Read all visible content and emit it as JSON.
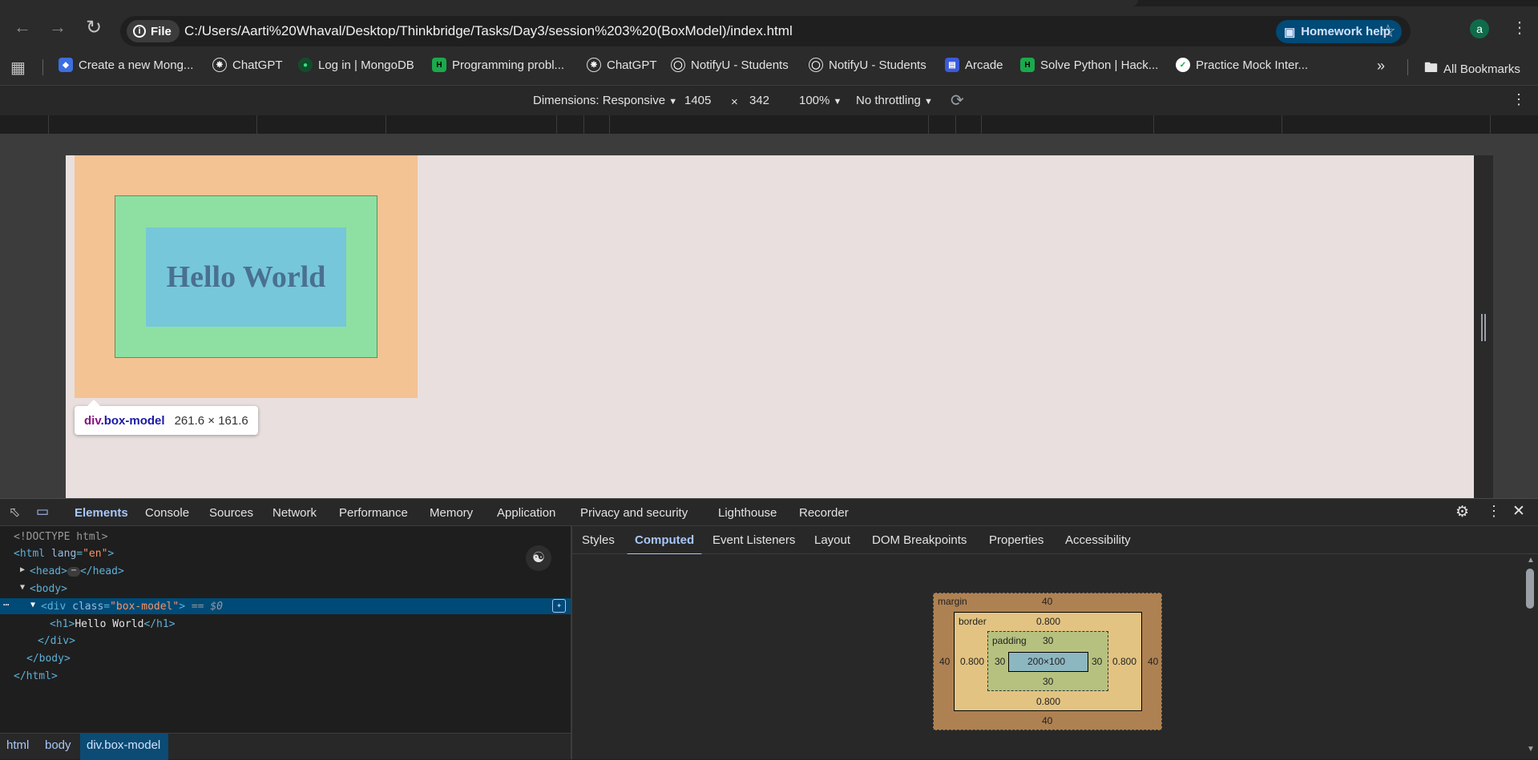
{
  "browser": {
    "file_chip": "File",
    "url": "C:/Users/Aarti%20Whaval/Desktop/Thinkbridge/Tasks/Day3/session%203%20(BoxModel)/index.html",
    "homework_help": "Homework help",
    "avatar_letter": "a"
  },
  "bookmarks": {
    "items": [
      {
        "label": "Create a new Mong...",
        "icon": "mongo-leaf-icon"
      },
      {
        "label": "ChatGPT",
        "icon": "chatgpt-icon"
      },
      {
        "label": "Log in | MongoDB",
        "icon": "mongodb-icon"
      },
      {
        "label": "Programming probl...",
        "icon": "hackerrank-icon"
      },
      {
        "label": "ChatGPT",
        "icon": "chatgpt-icon"
      },
      {
        "label": "NotifyU - Students",
        "icon": "globe-icon"
      },
      {
        "label": "NotifyU - Students",
        "icon": "globe-icon"
      },
      {
        "label": "Arcade",
        "icon": "arcade-icon"
      },
      {
        "label": "Solve Python | Hack...",
        "icon": "hackerrank-icon"
      },
      {
        "label": "Practice Mock Inter...",
        "icon": "check-icon"
      }
    ],
    "all_bookmarks": "All Bookmarks"
  },
  "device_toolbar": {
    "dimensions_label": "Dimensions: Responsive",
    "width": "1405",
    "times": "×",
    "height": "342",
    "zoom": "100%",
    "throttling": "No throttling"
  },
  "page": {
    "heading": "Hello World"
  },
  "tooltip": {
    "tag": "div",
    "class": ".box-model",
    "size": "261.6 × 161.6"
  },
  "devtools": {
    "tabs": [
      "Elements",
      "Console",
      "Sources",
      "Network",
      "Performance",
      "Memory",
      "Application",
      "Privacy and security",
      "Lighthouse",
      "Recorder"
    ],
    "active_tab": "Elements",
    "dom": {
      "doctype": "<!DOCTYPE html>",
      "html_open_tag": "html",
      "html_attr": "lang",
      "html_attr_val": "\"en\"",
      "head": "head",
      "body": "body",
      "div_tag": "div",
      "div_attr": "class",
      "div_attr_val": "\"box-model\"",
      "div_suffix": "== $0",
      "h1_text": "Hello World"
    },
    "breadcrumbs": [
      "html",
      "body",
      "div.box-model"
    ],
    "side_tabs": [
      "Styles",
      "Computed",
      "Event Listeners",
      "Layout",
      "DOM Breakpoints",
      "Properties",
      "Accessibility"
    ],
    "active_side_tab": "Computed",
    "box_model": {
      "margin_label": "margin",
      "border_label": "border",
      "padding_label": "padding",
      "margin": "40",
      "border": "0.800",
      "padding": "30",
      "content": "200×100"
    }
  }
}
